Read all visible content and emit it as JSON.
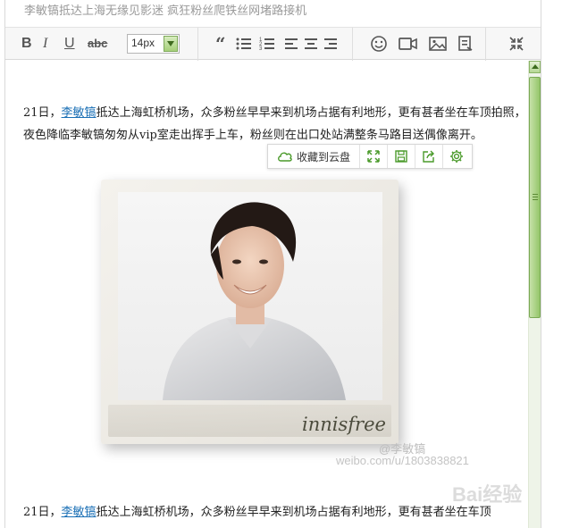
{
  "title": "李敏镐抵达上海无缘见影迷 疯狂粉丝爬铁丝网堵路接机",
  "toolbar": {
    "bold": "B",
    "italic": "I",
    "underline": "U",
    "strikethrough": "abc",
    "font_size": "14px"
  },
  "article": {
    "para1": {
      "prefix": "21日，",
      "link": "李敏镐",
      "text": "抵达上海虹桥机场，众多粉丝早早来到机场占据有利地形，更有甚者坐在车顶拍照，夜色降临李敏镐匆匆从vip室走出挥手上车，粉丝则在出口处站满整条马路目送偶像离开。"
    },
    "para2": {
      "prefix": "21日，",
      "link": "李敏镐",
      "text": "抵达上海虹桥机场，众多粉丝早早来到机场占据有利地形，更有甚者坐在车顶"
    }
  },
  "image": {
    "brand": "innisfree",
    "watermark_handle": "@李敏镐",
    "watermark_url": "weibo.com/u/1803838821",
    "watermark_site": "Bai经验"
  },
  "image_toolbar": {
    "save_to_cloud": "收藏到云盘"
  },
  "colors": {
    "accent_green": "#4a9a2a",
    "link_blue": "#1a6fb5",
    "scrollbar_green": "#95c66a"
  }
}
